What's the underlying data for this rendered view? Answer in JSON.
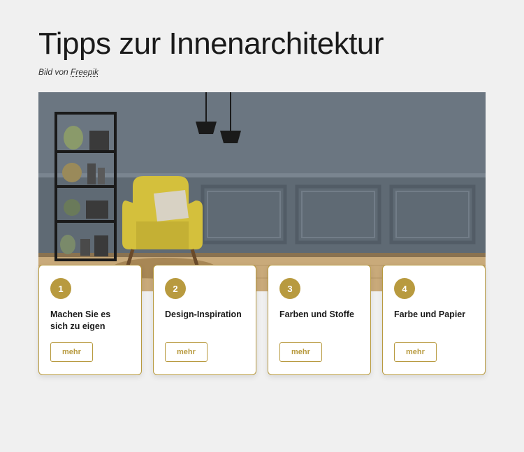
{
  "header": {
    "title": "Tipps zur Innenarchitektur",
    "credit_prefix": "Bild von ",
    "credit_link": "Freepik"
  },
  "cards": [
    {
      "num": "1",
      "title": "Machen Sie es sich zu eigen",
      "btn": "mehr"
    },
    {
      "num": "2",
      "title": "Design-Inspiration",
      "btn": "mehr"
    },
    {
      "num": "3",
      "title": "Farben und Stoffe",
      "btn": "mehr"
    },
    {
      "num": "4",
      "title": "Farbe und Papier",
      "btn": "mehr"
    }
  ]
}
